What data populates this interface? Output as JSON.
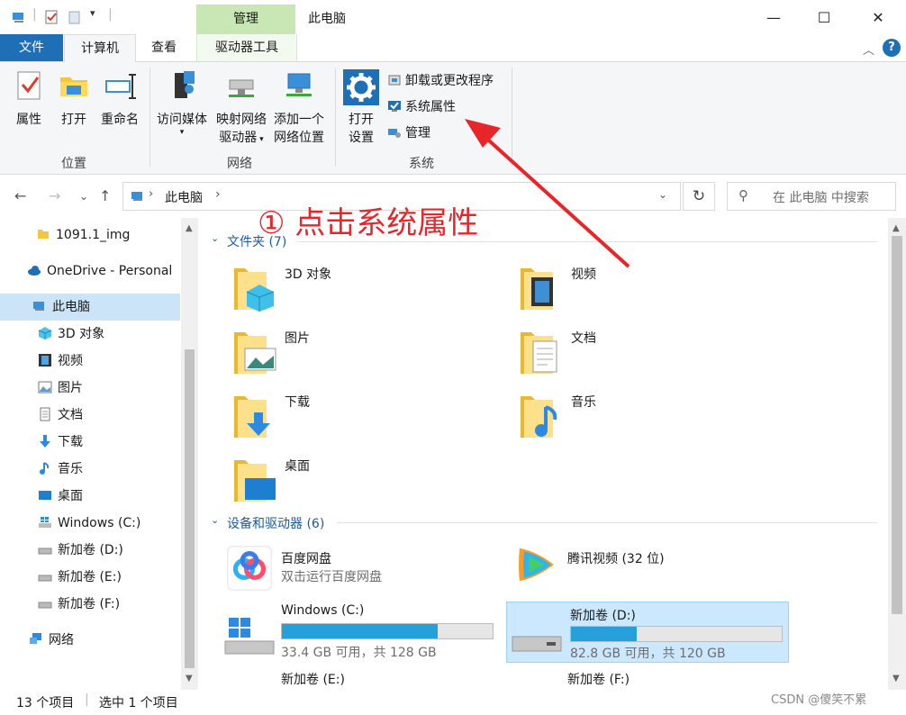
{
  "titlebar": {
    "context_tab": "管理",
    "title": "此电脑",
    "minimize": "—",
    "maximize": "☐",
    "close": "✕"
  },
  "tabs": {
    "file": "文件",
    "computer": "计算机",
    "view": "查看",
    "drive_tools": "驱动器工具"
  },
  "ribbon": {
    "location": {
      "label": "位置",
      "properties": "属性",
      "open": "打开",
      "rename": "重命名"
    },
    "network": {
      "label": "网络",
      "access_media": "访问媒体",
      "map_drive_1": "映射网络",
      "map_drive_2": "驱动器",
      "add_location_1": "添加一个",
      "add_location_2": "网络位置"
    },
    "system": {
      "label": "系统",
      "open_settings_1": "打开",
      "open_settings_2": "设置",
      "uninstall": "卸载或更改程序",
      "system_properties": "系统属性",
      "manage": "管理"
    }
  },
  "address": {
    "path": "此电脑",
    "search_placeholder": "在 此电脑 中搜索"
  },
  "sidebar": {
    "items": [
      {
        "label": "1091.1_img"
      },
      {
        "label": "OneDrive - Personal"
      },
      {
        "label": "此电脑"
      },
      {
        "label": "3D 对象"
      },
      {
        "label": "视频"
      },
      {
        "label": "图片"
      },
      {
        "label": "文档"
      },
      {
        "label": "下载"
      },
      {
        "label": "音乐"
      },
      {
        "label": "桌面"
      },
      {
        "label": "Windows (C:)"
      },
      {
        "label": "新加卷 (D:)"
      },
      {
        "label": "新加卷 (E:)"
      },
      {
        "label": "新加卷 (F:)"
      },
      {
        "label": "网络"
      }
    ]
  },
  "main": {
    "folders_header": "文件夹 (7)",
    "folders": [
      {
        "label": "3D 对象"
      },
      {
        "label": "视频"
      },
      {
        "label": "图片"
      },
      {
        "label": "文档"
      },
      {
        "label": "下载"
      },
      {
        "label": "音乐"
      },
      {
        "label": "桌面"
      }
    ],
    "devices_header": "设备和驱动器 (6)",
    "apps": [
      {
        "label": "百度网盘",
        "sub": "双击运行百度网盘"
      },
      {
        "label": "腾讯视频 (32 位)"
      }
    ],
    "drives": [
      {
        "label": "Windows (C:)",
        "free": "33.4 GB 可用，共 128 GB",
        "used_fraction": 0.74
      },
      {
        "label": "新加卷 (D:)",
        "free": "82.8 GB 可用，共 120 GB",
        "used_fraction": 0.31
      },
      {
        "label": "新加卷 (E:)"
      },
      {
        "label": "新加卷 (F:)"
      }
    ]
  },
  "status": {
    "count": "13 个项目",
    "selected": "选中 1 个项目"
  },
  "annotation": "① 点击系统属性",
  "watermark": "CSDN @傻笑不累",
  "colors": {
    "accent": "#1e6fb5",
    "context_tab": "#c8e7b5",
    "selection": "#cce8ff",
    "annotation": "#e8262a",
    "drive_bar": "#26a0da"
  }
}
